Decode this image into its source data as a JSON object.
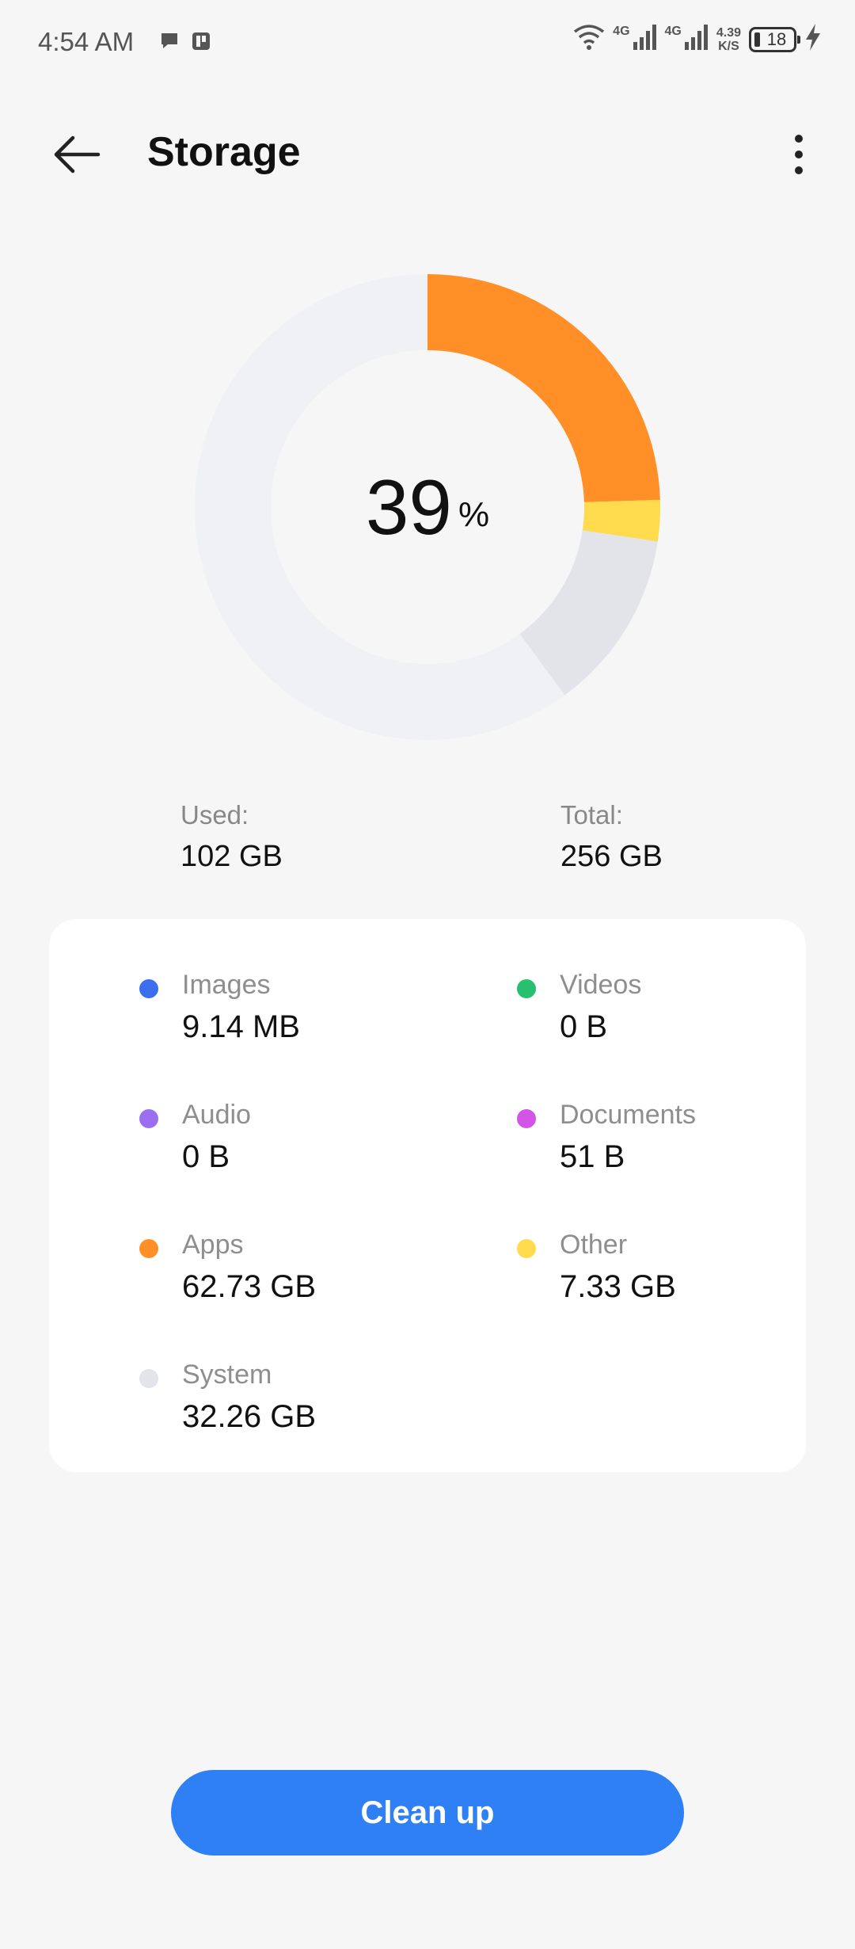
{
  "status_bar": {
    "time": "4:54 AM",
    "network_1": "4G",
    "network_2": "4G",
    "speed_value": "4.39",
    "speed_unit": "K/S",
    "battery": "18"
  },
  "header": {
    "title": "Storage"
  },
  "donut": {
    "percent": "39",
    "percent_sign": "%"
  },
  "summary": {
    "used_label": "Used:",
    "used_value": "102 GB",
    "total_label": "Total:",
    "total_value": "256 GB"
  },
  "categories": [
    {
      "name": "Images",
      "size": "9.14 MB",
      "color": "#3b6ff0"
    },
    {
      "name": "Videos",
      "size": "0 B",
      "color": "#26c06f"
    },
    {
      "name": "Audio",
      "size": "0 B",
      "color": "#9c6ef2"
    },
    {
      "name": "Documents",
      "size": "51 B",
      "color": "#d355e8"
    },
    {
      "name": "Apps",
      "size": "62.73 GB",
      "color": "#ff8f26"
    },
    {
      "name": "Other",
      "size": "7.33 GB",
      "color": "#ffdb4d"
    },
    {
      "name": "System",
      "size": "32.26 GB",
      "color": "#e3e4ea"
    }
  ],
  "cleanup_label": "Clean up",
  "chart_data": {
    "type": "pie",
    "total_gb": 256,
    "series": [
      {
        "name": "Apps",
        "value": 62.73,
        "color": "#ff8f26"
      },
      {
        "name": "Other",
        "value": 7.33,
        "color": "#ffdb4d"
      },
      {
        "name": "System",
        "value": 32.26,
        "color": "#e3e4ea"
      }
    ],
    "free_color": "#f0f1f5"
  }
}
